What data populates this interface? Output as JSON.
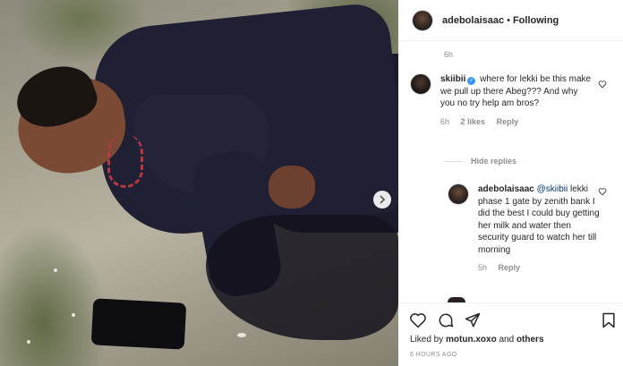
{
  "post": {
    "username": "adebolaisaac",
    "separator": "•",
    "follow_status": "Following",
    "time_ago_top": "6h",
    "liked_prefix": "Liked by",
    "liked_user": "motun.xoxo",
    "liked_and": "and",
    "liked_others": "others",
    "timestamp": "6 HOURS AGO"
  },
  "comments": [
    {
      "username": "skiibii",
      "verified": true,
      "text": "where for lekki be this make we pull up there Abeg??? And why you no try help am bros?",
      "time": "6h",
      "likes": "2 likes",
      "reply_label": "Reply"
    }
  ],
  "hide_replies_label": "Hide replies",
  "replies": [
    {
      "username": "adebolaisaac",
      "mention": "@skiibii",
      "text": "lekki phase 1 gate by zenith bank I did the best I could buy getting her milk and water then security guard to watch her till morning",
      "time": "5h",
      "reply_label": "Reply"
    }
  ],
  "icons": {
    "carousel": "chevron-right-icon",
    "like": "heart-icon",
    "comment": "comment-icon",
    "share": "paper-plane-icon",
    "save": "bookmark-icon",
    "verified": "verified-badge-icon"
  },
  "colors": {
    "link": "#00376b",
    "verified": "#3897f0",
    "muted": "#8e8e8e",
    "text": "#262626"
  }
}
